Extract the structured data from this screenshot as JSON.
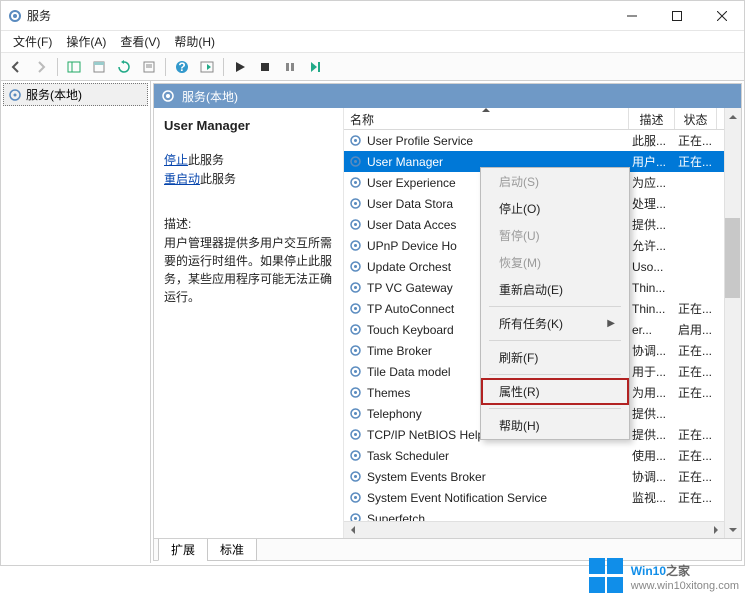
{
  "window": {
    "title": "服务"
  },
  "menubar": [
    "文件(F)",
    "操作(A)",
    "查看(V)",
    "帮助(H)"
  ],
  "tree": {
    "root": "服务(本地)"
  },
  "content_header": "服务(本地)",
  "detail": {
    "service_name": "User Manager",
    "stop_link": "停止",
    "stop_suffix": "此服务",
    "restart_link": "重启动",
    "restart_suffix": "此服务",
    "desc_label": "描述:",
    "desc_text": "用户管理器提供多用户交互所需要的运行时组件。如果停止此服务，某些应用程序可能无法正确运行。"
  },
  "columns": {
    "name": "名称",
    "desc": "描述",
    "status": "状态"
  },
  "rows": [
    {
      "name": "User Profile Service",
      "desc": "此服...",
      "stat": "正在..."
    },
    {
      "name": "User Manager",
      "desc": "用户...",
      "stat": "正在...",
      "selected": true
    },
    {
      "name": "User Experience",
      "desc": "为应...",
      "stat": ""
    },
    {
      "name": "User Data Stora",
      "desc": "处理...",
      "stat": ""
    },
    {
      "name": "User Data Acces",
      "desc": "提供...",
      "stat": ""
    },
    {
      "name": "UPnP Device Ho",
      "desc": "允许...",
      "stat": ""
    },
    {
      "name": "Update Orchest",
      "desc": "Uso...",
      "stat": ""
    },
    {
      "name": "TP VC Gateway",
      "desc": "Thin...",
      "stat": ""
    },
    {
      "name": "TP AutoConnect",
      "desc": "Thin...",
      "stat": "正在..."
    },
    {
      "name": "Touch Keyboard",
      "desc": "er...",
      "stat": "启用..."
    },
    {
      "name": "Time Broker",
      "desc": "协调...",
      "stat": "正在..."
    },
    {
      "name": "Tile Data model",
      "desc": "用于...",
      "stat": "正在..."
    },
    {
      "name": "Themes",
      "desc": "为用...",
      "stat": "正在..."
    },
    {
      "name": "Telephony",
      "desc": "提供...",
      "stat": ""
    },
    {
      "name": "TCP/IP NetBIOS Helper",
      "desc": "提供...",
      "stat": "正在..."
    },
    {
      "name": "Task Scheduler",
      "desc": "使用...",
      "stat": "正在..."
    },
    {
      "name": "System Events Broker",
      "desc": "协调...",
      "stat": "正在..."
    },
    {
      "name": "System Event Notification Service",
      "desc": "监视...",
      "stat": "正在..."
    },
    {
      "name": "Superfetch",
      "desc": "",
      "stat": ""
    }
  ],
  "context_menu": [
    {
      "label": "启动(S)",
      "disabled": true
    },
    {
      "label": "停止(O)"
    },
    {
      "label": "暂停(U)",
      "disabled": true
    },
    {
      "label": "恢复(M)",
      "disabled": true
    },
    {
      "label": "重新启动(E)"
    },
    {
      "sep": true
    },
    {
      "label": "所有任务(K)",
      "submenu": true
    },
    {
      "sep": true
    },
    {
      "label": "刷新(F)"
    },
    {
      "sep": true
    },
    {
      "label": "属性(R)",
      "highlight": true
    },
    {
      "sep": true
    },
    {
      "label": "帮助(H)"
    }
  ],
  "tabs": {
    "extended": "扩展",
    "standard": "标准"
  },
  "watermark": {
    "brand_prefix": "Win10",
    "brand_suffix": "之家",
    "url": "www.win10xitong.com"
  }
}
